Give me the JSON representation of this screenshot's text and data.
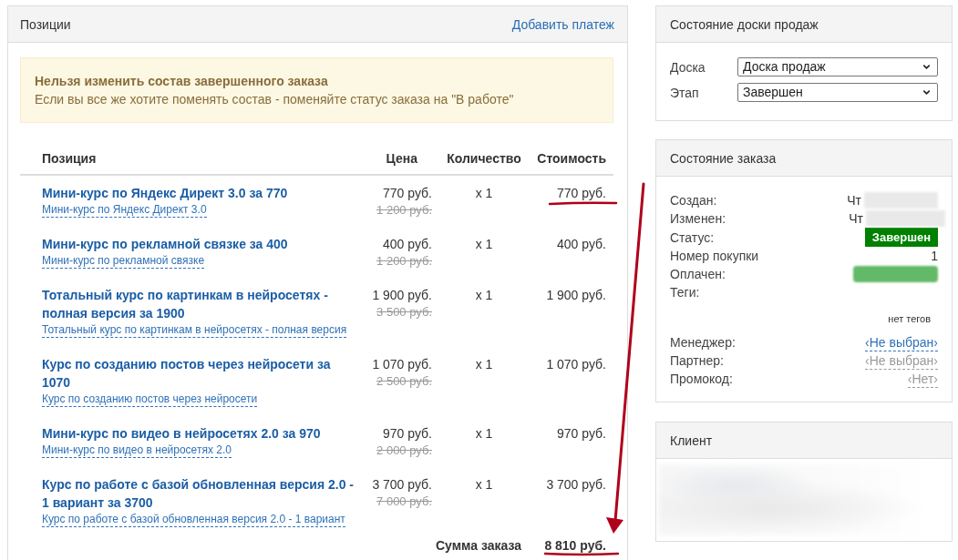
{
  "positions_panel": {
    "title": "Позиции",
    "action": "Добавить платеж",
    "alert": {
      "title": "Нельзя изменить состав завершенного заказа",
      "text": "Если вы все же хотите поменять состав - поменяйте статус заказа на \"В работе\""
    },
    "table": {
      "columns": [
        "Позиция",
        "Цена",
        "Количество",
        "Стоимость"
      ],
      "rows": [
        {
          "name": "Мини-курс по Яндекс Директ 3.0 за 770",
          "product": "Мини-курс по Яндекс Директ 3.0",
          "price": "770 руб.",
          "old_price": "1 200 руб.",
          "quantity": "x 1",
          "cost": "770 руб."
        },
        {
          "name": "Мини-курс по рекламной связке за 400",
          "product": "Мини-курс по рекламной связке",
          "price": "400 руб.",
          "old_price": "1 200 руб.",
          "quantity": "x 1",
          "cost": "400 руб."
        },
        {
          "name": "Тотальный курс по картинкам в нейросетях - полная версия за 1900",
          "product": "Тотальный курс по картинкам в нейросетях - полная версия",
          "price": "1 900 руб.",
          "old_price": "3 500 руб.",
          "quantity": "x 1",
          "cost": "1 900 руб."
        },
        {
          "name": "Курс по созданию постов через нейросети за 1070",
          "product": "Курс по созданию постов через нейросети",
          "price": "1 070 руб.",
          "old_price": "2 500 руб.",
          "quantity": "x 1",
          "cost": "1 070 руб."
        },
        {
          "name": "Мини-курс по видео в нейросетях 2.0 за 970",
          "product": "Мини-курс по видео в нейросетях 2.0",
          "price": "970 руб.",
          "old_price": "2 000 руб.",
          "quantity": "x 1",
          "cost": "970 руб."
        },
        {
          "name": "Курс по работе с базой обновленная версия 2.0 - 1 вариант за 3700",
          "product": "Курс по работе с базой обновленная версия 2.0 - 1 вариант",
          "price": "3 700 руб.",
          "old_price": "7 000 руб.",
          "quantity": "x 1",
          "cost": "3 700 руб."
        }
      ],
      "total": {
        "label": "Сумма заказа",
        "value": "8 810 руб."
      }
    }
  },
  "board_panel": {
    "title": "Состояние доски продаж",
    "fields": [
      {
        "label": "Доска",
        "value": "Доска продаж"
      },
      {
        "label": "Этап",
        "value": "Завершен"
      }
    ]
  },
  "order_panel": {
    "title": "Состояние заказа",
    "rows": [
      {
        "kind": "date",
        "label": "Создан:",
        "value": "Чт",
        "redacted": true
      },
      {
        "kind": "date",
        "label": "Изменен:",
        "value": "Чт",
        "redacted": true
      },
      {
        "kind": "badge",
        "label": "Статус:",
        "value": "Завершен",
        "color": "#008000"
      },
      {
        "kind": "text",
        "label": "Номер покупки",
        "value": "1"
      },
      {
        "kind": "hidden",
        "label": "Оплачен:"
      },
      {
        "kind": "tags",
        "label": "Теги:",
        "empty_text": "нет тегов"
      },
      {
        "kind": "link",
        "label": "Менеджер:",
        "value": "‹Не выбран›",
        "disabled": false
      },
      {
        "kind": "link",
        "label": "Партнер:",
        "value": "‹Не выбран›",
        "disabled": true
      },
      {
        "kind": "link",
        "label": "Промокод:",
        "value": "‹Нет›",
        "disabled": true
      }
    ]
  },
  "client_panel": {
    "title": "Клиент"
  }
}
